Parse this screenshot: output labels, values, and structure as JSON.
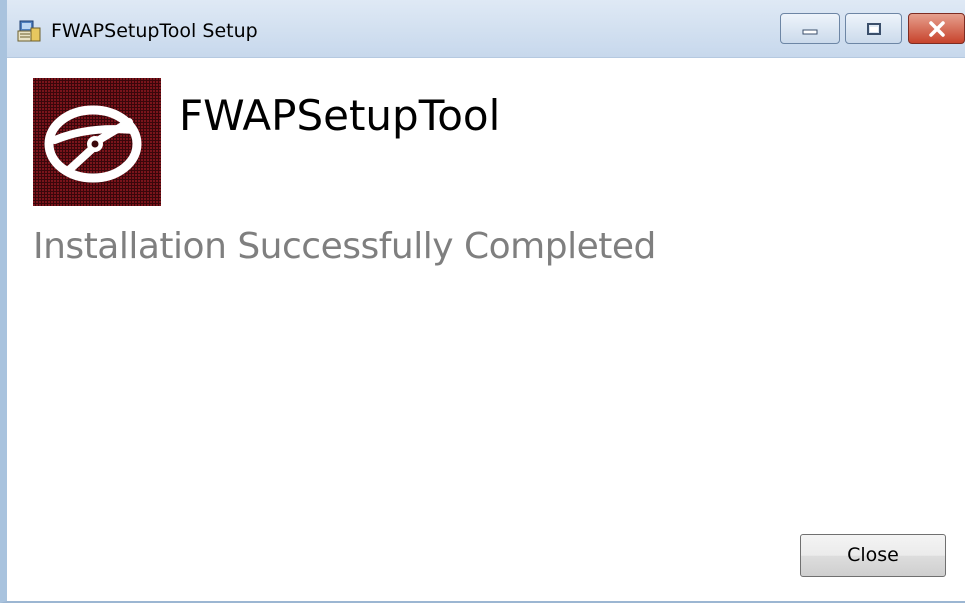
{
  "window": {
    "title": "FWAPSetupTool Setup",
    "icons": {
      "app": "installer-icon",
      "minimize": "minimize-icon",
      "maximize": "maximize-icon",
      "close": "close-icon"
    }
  },
  "header": {
    "product_name": "FWAPSetupTool",
    "logo_icon": "disc-icon"
  },
  "body": {
    "status": "Installation Successfully Completed"
  },
  "footer": {
    "close_label": "Close"
  },
  "colors": {
    "titlebar": "#c7d8ec",
    "status_text": "#7f7f7f",
    "logo_background": "#4a0c10",
    "close_window_button": "#c7432c"
  }
}
